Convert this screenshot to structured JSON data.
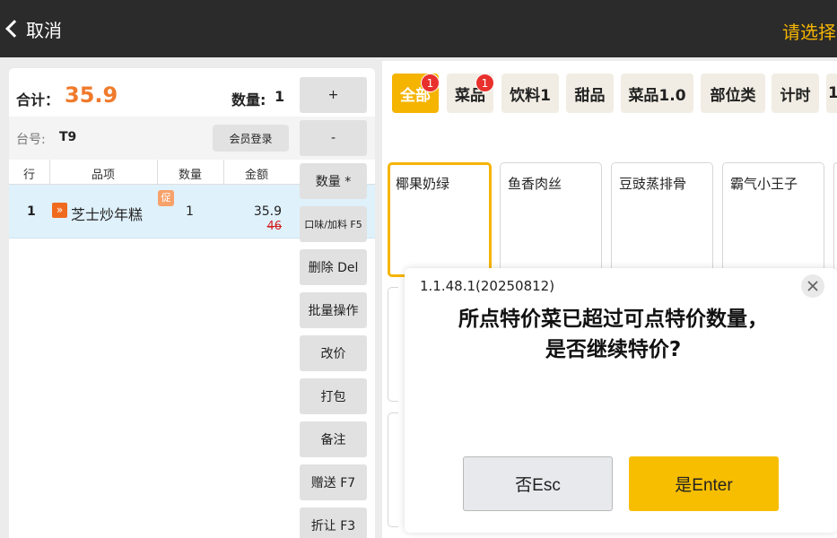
{
  "topbar": {
    "back_label": "取消",
    "right_text": "请选择"
  },
  "order": {
    "total_label": "合计：",
    "total_value": "35.9",
    "qty_label": "数量:",
    "qty_value": "1",
    "table_label": "台号:",
    "table_value": "T9",
    "member_login_label": "会员登录",
    "columns": [
      "行",
      "品项",
      "数量",
      "金额"
    ],
    "rows": [
      {
        "no": "1",
        "name": "芝士炒年糕",
        "badge": "»",
        "promo_tag": "促",
        "qty": "1",
        "amount": "35.9",
        "original_amount": "46"
      }
    ]
  },
  "actions": [
    "+",
    "-",
    "数量 *",
    "口味/加料 F5",
    "删除 Del",
    "批量操作",
    "改价",
    "打包",
    "备注",
    "赠送 F7",
    "折让 F3"
  ],
  "categories": [
    {
      "label": "全部",
      "badge": "1",
      "active": true
    },
    {
      "label": "菜品",
      "badge": "1",
      "active": false
    },
    {
      "label": "饮料1",
      "badge": "",
      "active": false
    },
    {
      "label": "甜品",
      "badge": "",
      "active": false
    },
    {
      "label": "菜品1.0",
      "badge": "",
      "active": false
    },
    {
      "label": "部位类",
      "badge": "",
      "active": false
    },
    {
      "label": "计时",
      "badge": "",
      "active": false
    },
    {
      "label": "1",
      "badge": "",
      "active": false
    }
  ],
  "dishes": [
    "椰果奶绿",
    "鱼香肉丝",
    "豆豉蒸排骨",
    "霸气小王子"
  ],
  "dialog": {
    "version": "1.1.48.1(20250812)",
    "message_line1": "所点特价菜已超过可点特价数量，",
    "message_line2": "是否继续特价?",
    "no_label": "否Esc",
    "yes_label": "是Enter"
  },
  "colors": {
    "accent": "#f5b400",
    "total": "#f07a2c",
    "badge_red": "#e8302c",
    "topbar": "#2b2b2b"
  }
}
